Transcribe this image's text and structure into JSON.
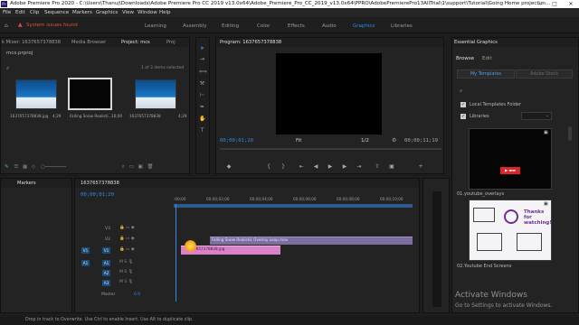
{
  "window": {
    "title": "Adobe Premiere Pro 2020 - C:\\Users\\Thanuj\\Downloads\\Adobe Premiere Pro CC 2019 v13.0x64\\Adobe_Premiere_Pro_CC_2019_v13.0x64\\PPRO\\AdobePremierePro13AllTrial\\1\\support\\Tutorial\\Going Home project\\m...",
    "min": "—",
    "max": "□",
    "close": "✕"
  },
  "menu": [
    "File",
    "Edit",
    "Clip",
    "Sequence",
    "Markers",
    "Graphics",
    "View",
    "Window",
    "Help"
  ],
  "alert": "System issues found",
  "workspaces": [
    "Learning",
    "Assembly",
    "Editing",
    "Color",
    "Effects",
    "Audio",
    "Graphics",
    "Libraries"
  ],
  "workspace_active": "Graphics",
  "project": {
    "tabs": [
      "k Mixer: 1637657378838",
      "Media Browser",
      "Project: mcs",
      "Proj"
    ],
    "file": "mcs.prproj",
    "count": "1 of 3 items selected",
    "items": [
      {
        "name": "1637657378838.jpg",
        "dur": "4;29"
      },
      {
        "name": "Falling Snow Realisti...",
        "dur": "10;00"
      },
      {
        "name": "1637657378838",
        "dur": "4;29"
      }
    ]
  },
  "program": {
    "title": "Program: 1637657378838",
    "tc_left": "00;00;01;20",
    "fit": "Fit",
    "ratio": "1/2",
    "tc_right": "00;00;11;19"
  },
  "timeline": {
    "tab": "1637657378838",
    "tc": "00;00;01;20",
    "ruler": [
      ":00;00",
      "00;00;02;00",
      "00;00;04;00",
      "00;00;06;00",
      "00;00;08;00",
      "00;00;10;00"
    ],
    "video_tracks": [
      "V3",
      "V2",
      "V1"
    ],
    "audio_tracks": [
      "A1",
      "A2",
      "A3"
    ],
    "master": "Master",
    "master_val": "0.0",
    "clip_video": "Falling Snow Realistic Overlay Loop.mov",
    "clip_photo": "1637657378838.jpg"
  },
  "markers_tab": "Markers",
  "essential": {
    "title": "Essential Graphics",
    "tabs": [
      "Browse",
      "Edit"
    ],
    "buttons": [
      "My Templates",
      "Adobe Stock"
    ],
    "local": "Local Templates Folder",
    "libraries": "Libraries",
    "templates": [
      {
        "name": "01.youtube_overlays"
      },
      {
        "name": "02.Youtube End Screens"
      }
    ],
    "thanks": "Thanks for watching!"
  },
  "status": "Drop in track to Overwrite. Use Ctrl to enable Insert. Use Alt to duplicate clip.",
  "watermark": {
    "line1": "Activate Windows",
    "line2": "Go to Settings to activate Windows."
  }
}
